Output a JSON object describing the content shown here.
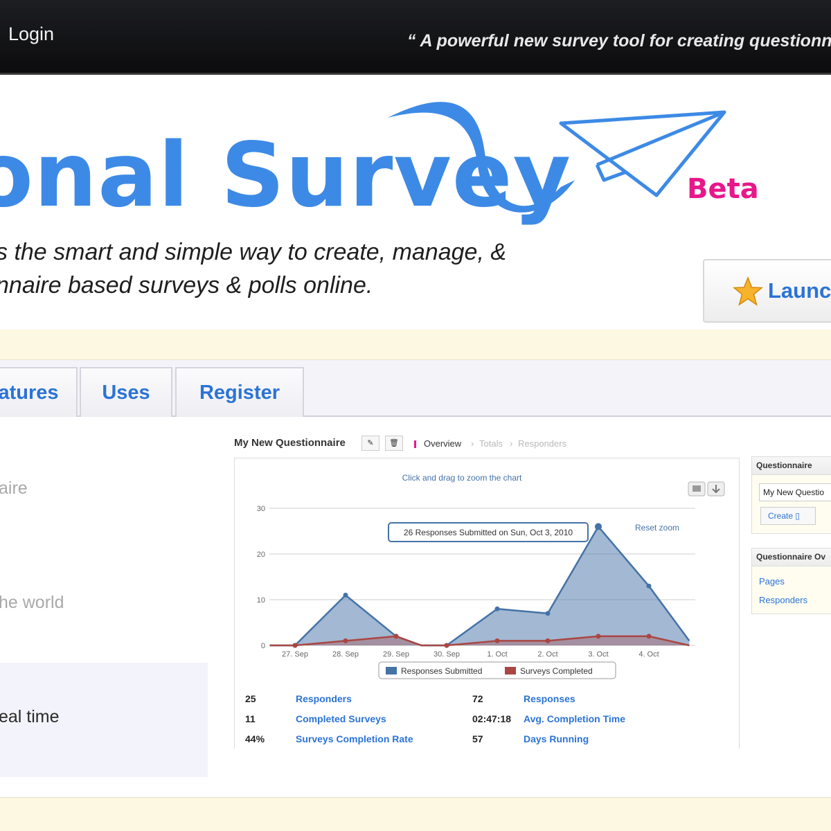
{
  "topbar": {
    "login": "Login",
    "tagline": "“ A powerful new survey tool for creating questionna"
  },
  "header": {
    "logo_text": "onal Survey",
    "beta": "Beta",
    "desc_line1": "s the smart and simple way to create, manage, &",
    "desc_line2": "nnaire based surveys & polls online.",
    "launch_label": "Launch"
  },
  "tabs": [
    {
      "label": "atures"
    },
    {
      "label": "Uses"
    },
    {
      "label": "Register"
    }
  ],
  "left": {
    "item1": "aire",
    "item2": "he world",
    "item3": "eal time"
  },
  "screenshot": {
    "title": "My New Questionnaire",
    "breadcrumb": {
      "active": "Overview",
      "sep1": "›",
      "item2": "Totals",
      "sep2": "›",
      "item3": "Responders"
    }
  },
  "chart_data": {
    "type": "area",
    "title": "Click and drag to zoom the chart",
    "reset_zoom": "Reset zoom",
    "tooltip": "26 Responses Submitted on Sun, Oct 3, 2010",
    "ylim": [
      0,
      30
    ],
    "yticks": [
      "0",
      "10",
      "20",
      "30"
    ],
    "xticks": [
      "27. Sep",
      "28. Sep",
      "29. Sep",
      "30. Sep",
      "1. Oct",
      "2. Oct",
      "3. Oct",
      "4. Oct"
    ],
    "series": [
      {
        "name": "Responses Submitted",
        "color": "#4572a7",
        "points": [
          [
            -0.5,
            0
          ],
          [
            0,
            0
          ],
          [
            1,
            11
          ],
          [
            2,
            2
          ],
          [
            2.5,
            0
          ],
          [
            3,
            0
          ],
          [
            4,
            8
          ],
          [
            5,
            7
          ],
          [
            6,
            26
          ],
          [
            7,
            13
          ],
          [
            7.8,
            1
          ]
        ]
      },
      {
        "name": "Surveys Completed",
        "color": "#aa4643",
        "points": [
          [
            -0.5,
            0
          ],
          [
            0,
            0
          ],
          [
            1,
            1
          ],
          [
            2,
            2
          ],
          [
            2.5,
            0
          ],
          [
            3,
            0
          ],
          [
            4,
            1
          ],
          [
            5,
            1
          ],
          [
            6,
            2
          ],
          [
            7,
            2
          ],
          [
            7.8,
            0
          ]
        ]
      }
    ]
  },
  "stats": [
    {
      "value": "25",
      "label": "Responders"
    },
    {
      "value": "72",
      "label": "Responses"
    },
    {
      "value": "11",
      "label": "Completed Surveys"
    },
    {
      "value": "02:47:18",
      "label": "Avg. Completion Time"
    },
    {
      "value": "44%",
      "label": "Surveys Completion Rate"
    },
    {
      "value": "57",
      "label": "Days Running"
    }
  ],
  "panel1": {
    "title": "Questionnaire",
    "input_value": "My New Questio",
    "create_label": "Create"
  },
  "panel2": {
    "title": "Questionnaire Ov",
    "link1": "Pages",
    "link2": "Responders"
  },
  "colors": {
    "brand_blue": "#3d8ae6",
    "link_blue": "#2b73d6",
    "beta_pink": "#e8188a",
    "band_cream": "#fdf8e2"
  }
}
